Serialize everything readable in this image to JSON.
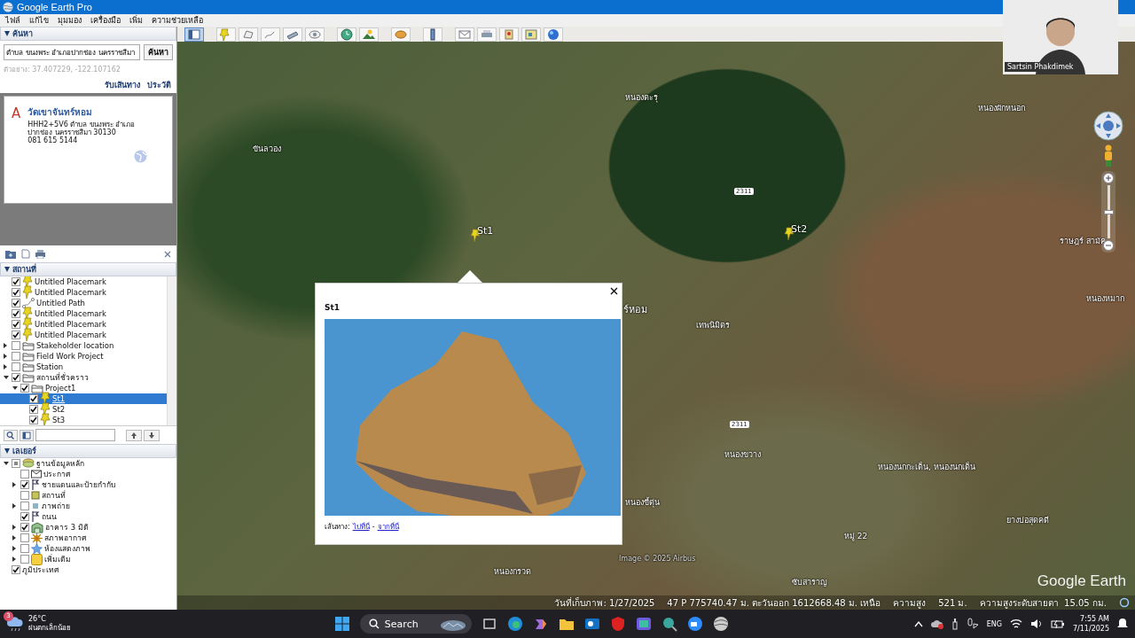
{
  "window": {
    "title": "Google Earth Pro"
  },
  "menu": [
    {
      "label": "ไฟล์"
    },
    {
      "label": "แก้ไข"
    },
    {
      "label": "มุมมอง"
    },
    {
      "label": "เครื่องมือ"
    },
    {
      "label": "เพิ่ม"
    },
    {
      "label": "ความช่วยเหลือ"
    }
  ],
  "search": {
    "header": "ค้นหา",
    "value": "ตำบล ขนงพระ อำเภอปากช่อง นครราชสีมา",
    "button": "ค้นหา",
    "example": "ตัวอย่าง: 37.407229, -122.107162",
    "links": [
      "รับเส้นทาง",
      "ประวัติ"
    ]
  },
  "search_result": {
    "marker": "A",
    "title": "วัดเขาจันทร์หอม",
    "lines": [
      "HHH2+5V6 ตำบล ขนงพระ อำเภอ",
      "ปากช่อง นครราชสีมา 30130",
      "081 615 5144"
    ]
  },
  "places": {
    "header": "สถานที่",
    "items": [
      {
        "label": "Untitled Placemark",
        "kind": "placemark",
        "checked": true,
        "selected": false
      },
      {
        "label": "Untitled Placemark",
        "kind": "placemark",
        "checked": true,
        "selected": false
      },
      {
        "label": "Untitled Path",
        "kind": "path",
        "checked": true,
        "selected": false
      },
      {
        "label": "Untitled Placemark",
        "kind": "placemark",
        "checked": true,
        "selected": false
      },
      {
        "label": "Untitled Placemark",
        "kind": "placemark",
        "checked": true,
        "selected": false
      },
      {
        "label": "Untitled Placemark",
        "kind": "placemark",
        "checked": true,
        "selected": false
      },
      {
        "label": "Stakeholder location",
        "kind": "folder",
        "checked": false,
        "expanded": false,
        "selected": false
      },
      {
        "label": "Field Work Project",
        "kind": "folder",
        "checked": false,
        "expanded": false,
        "selected": false
      },
      {
        "label": "Station",
        "kind": "folder",
        "checked": false,
        "expanded": false,
        "selected": false
      },
      {
        "label": "สถานที่ชั่วคราว",
        "kind": "folder",
        "checked": true,
        "expanded": true,
        "selected": false,
        "children": [
          {
            "label": "Project1",
            "kind": "folder",
            "checked": true,
            "expanded": true,
            "selected": false,
            "children": [
              {
                "label": "St1",
                "kind": "placemark",
                "checked": true,
                "selected": true
              },
              {
                "label": "St2",
                "kind": "placemark",
                "checked": true,
                "selected": false
              },
              {
                "label": "St3",
                "kind": "placemark",
                "checked": true,
                "selected": false
              }
            ]
          }
        ]
      }
    ]
  },
  "layers": {
    "header": "เลเยอร์",
    "items": [
      {
        "label": "ฐานข้อมูลหลัก",
        "kind": "database",
        "checked": true,
        "partial": true,
        "expanded": true,
        "selected": false,
        "children": [
          {
            "label": "ประกาศ",
            "kind": "mail",
            "checked": false,
            "selected": false
          },
          {
            "label": "ชายแดนและป้ายกำกับ",
            "kind": "flag",
            "checked": true,
            "expanded": false,
            "selected": false
          },
          {
            "label": "สถานที่",
            "kind": "square",
            "checked": false,
            "selected": false
          },
          {
            "label": "ภาพถ่าย",
            "kind": "photo",
            "checked": false,
            "expanded": false,
            "selected": false
          },
          {
            "label": "ถนน",
            "kind": "flag",
            "checked": true,
            "selected": false
          },
          {
            "label": "อาคาร 3 มิติ",
            "kind": "building",
            "checked": true,
            "expanded": false,
            "selected": false
          },
          {
            "label": "สภาพอากาศ",
            "kind": "sun",
            "checked": false,
            "expanded": false,
            "selected": false
          },
          {
            "label": "ห้องแสดงภาพ",
            "kind": "star",
            "checked": false,
            "expanded": false,
            "selected": false
          },
          {
            "label": "เพิ่มเติม",
            "kind": "note",
            "checked": false,
            "expanded": false,
            "selected": false
          }
        ]
      },
      {
        "label": "ภูมิประเทศ",
        "kind": "none",
        "checked": true,
        "selected": false
      }
    ]
  },
  "map": {
    "labels": [
      {
        "text": "หนองตะรุ",
        "kind": "place"
      },
      {
        "text": "ขันลวอง",
        "kind": "place"
      },
      {
        "text": "หนองผักหนอก",
        "kind": "place"
      },
      {
        "text": "2311",
        "kind": "road"
      },
      {
        "text": "ราษฎร์ สามัค",
        "kind": "place"
      },
      {
        "text": "หนองหมาก",
        "kind": "place"
      },
      {
        "text": "ร์หอม",
        "kind": "landmark"
      },
      {
        "text": "เทพนิมิตร",
        "kind": "place"
      },
      {
        "text": "2311",
        "kind": "road"
      },
      {
        "text": "หนองขวาง",
        "kind": "place"
      },
      {
        "text": "หนองนกกะเต็น, หนองนกเต็น",
        "kind": "place"
      },
      {
        "text": "หนองขี้ตุ่น",
        "kind": "place"
      },
      {
        "text": "ยางบ่อสุดคดี",
        "kind": "place"
      },
      {
        "text": "หมู่ 22",
        "kind": "place"
      },
      {
        "text": "Image © 2025 Airbus",
        "kind": "credit"
      },
      {
        "text": "หนองกรวด",
        "kind": "place"
      },
      {
        "text": "ซับสาราญ",
        "kind": "place"
      }
    ],
    "pins": [
      {
        "label": "St1"
      },
      {
        "label": "St2"
      }
    ],
    "logo": "Google Earth",
    "zoom_slider": {
      "level": 0.5
    },
    "popup": {
      "title": "St1",
      "directions_label": "เส้นทาง:",
      "links": [
        "ไปที่นี่",
        "จากที่นี่"
      ],
      "separator": "-"
    },
    "status_bar": [
      "วันที่เก็บภาพ: 1/27/2025",
      "47 P 775740.47 ม. ตะวันออก 1612668.48 ม. เหนือ",
      "ความสูง",
      "521 ม.",
      "ความสูงระดับสายตา  15.05 กม."
    ]
  },
  "webcam": {
    "name": "Sartsin Phakdimek"
  },
  "taskbar": {
    "temperature": "26°C",
    "weather": "ฝนตกเล็กน้อย",
    "badge": "3",
    "search": "Search",
    "language": "ENG",
    "time": "7:55 AM",
    "date": "7/11/2025"
  }
}
